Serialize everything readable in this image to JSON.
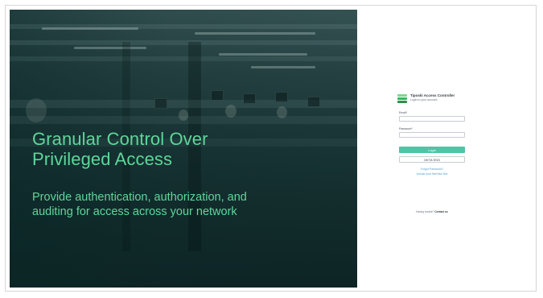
{
  "hero": {
    "headline_line1": "Granular Control Over",
    "headline_line2": "Privileged Access",
    "subline_line1": "Provide authentication, authorization, and",
    "subline_line2": "auditing for access across your network"
  },
  "login": {
    "product_name": "Tiposki Access Controller",
    "product_subtitle": "Login to your account",
    "email_label": "Email*",
    "email_value": "",
    "password_label": "Password*",
    "password_value": "",
    "login_button": "Login",
    "sso_button": "OKTA SSO",
    "forgot_password": "Forgot Password?",
    "unlock_account": "Unlock your NetVisa Sub",
    "footer_prefix": "Having trouble?",
    "footer_link": "Contact us"
  },
  "colors": {
    "accent_green": "#5dd79a",
    "login_button": "#4fc4a6",
    "link_blue": "#4aa0d8",
    "logo_colors": [
      "#2f8f4a",
      "#3bb35f",
      "#7bd88f"
    ]
  }
}
